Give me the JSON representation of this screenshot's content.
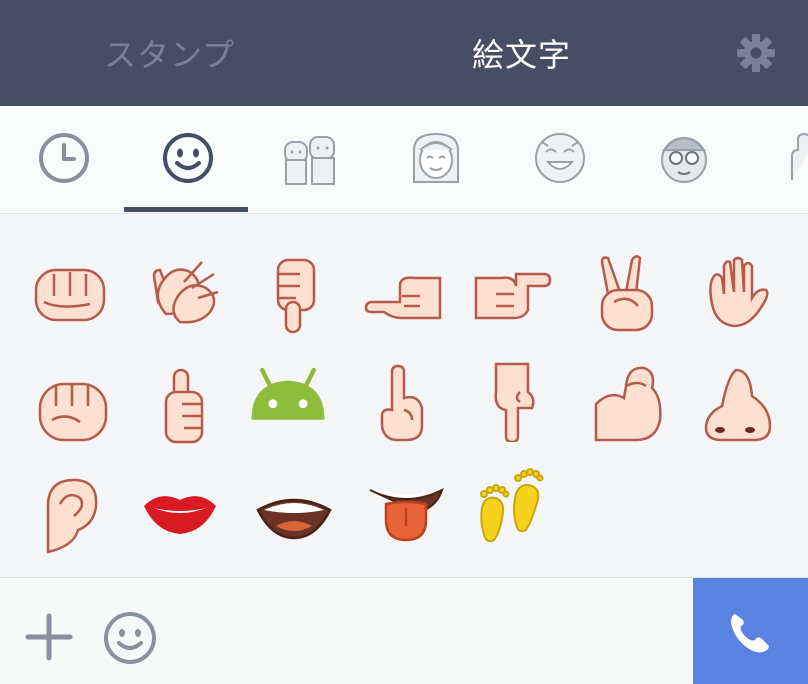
{
  "header": {
    "tab_stamp_label": "スタンプ",
    "tab_emoji_label": "絵文字",
    "settings_icon": "gear-icon"
  },
  "categories": [
    {
      "name": "recent",
      "icon": "clock-icon"
    },
    {
      "name": "face",
      "icon": "smiley-icon",
      "selected": true
    },
    {
      "name": "people",
      "icon": "couple-icon"
    },
    {
      "name": "person",
      "icon": "woman-face-icon"
    },
    {
      "name": "face-stamp",
      "icon": "grin-face-icon"
    },
    {
      "name": "character",
      "icon": "cap-boy-icon"
    },
    {
      "name": "hands",
      "icon": "hand-icon"
    }
  ],
  "emojis": [
    "fist-icon",
    "clapping-hands-icon",
    "thumbs-down-icon",
    "point-left-icon",
    "point-right-icon",
    "victory-hand-icon",
    "open-hand-icon",
    "raised-fist-icon",
    "thumbs-up-icon",
    "android-icon",
    "point-up-icon",
    "point-down-icon",
    "flexed-biceps-icon",
    "nose-icon",
    "ear-icon",
    "lips-icon",
    "mouth-icon",
    "tongue-icon",
    "footprints-icon"
  ],
  "bottom": {
    "add_icon": "plus-icon",
    "emoji_icon": "smiley-icon",
    "call_icon": "phone-icon"
  },
  "colors": {
    "header_bg": "#464e63",
    "accent_blue": "#5a82e0",
    "skin": "#fde0cf",
    "outline": "#b45b4c"
  }
}
